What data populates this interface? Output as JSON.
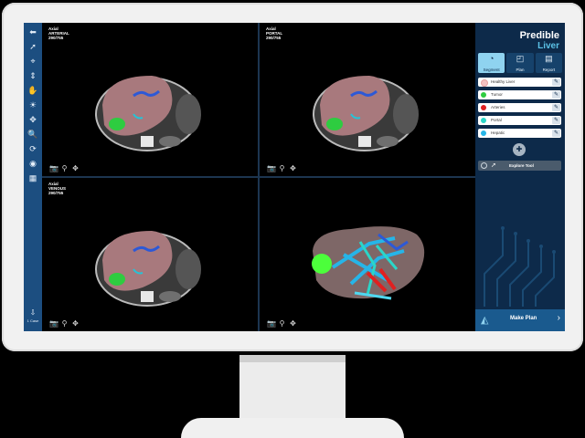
{
  "toolbar": {
    "tools": [
      {
        "name": "back-icon",
        "glyph": "⬅"
      },
      {
        "name": "pointer-icon",
        "glyph": "➚"
      },
      {
        "name": "crosshair-icon",
        "glyph": "⌖"
      },
      {
        "name": "scroll-icon",
        "glyph": "⇕"
      },
      {
        "name": "pan-hand-icon",
        "glyph": "✋"
      },
      {
        "name": "window-level-icon",
        "glyph": "☀"
      },
      {
        "name": "move-icon",
        "glyph": "✥"
      },
      {
        "name": "zoom-icon",
        "glyph": "🔍"
      },
      {
        "name": "rotate-icon",
        "glyph": "⟳"
      },
      {
        "name": "visibility-icon",
        "glyph": "◉"
      },
      {
        "name": "layout-icon",
        "glyph": "▦"
      }
    ],
    "bottom_label": "1 Case"
  },
  "viewports": [
    {
      "line1": "Axial",
      "line2": "ARTERIAL",
      "line3": "290/755"
    },
    {
      "line1": "Axial",
      "line2": "PORTAL",
      "line3": "290/755"
    },
    {
      "line1": "Axial",
      "line2": "VENOUS",
      "line3": "290/755"
    },
    {
      "line1": "",
      "line2": "",
      "line3": ""
    }
  ],
  "viewport_tools": [
    "📷",
    "⚲",
    "✥"
  ],
  "panel": {
    "brand_main": "Predible",
    "brand_sub": "Liver",
    "tabs": [
      {
        "label": "Segment",
        "icon": "◔",
        "active": true
      },
      {
        "label": "Plan",
        "icon": "◰",
        "active": false
      },
      {
        "label": "Report",
        "icon": "▤",
        "active": false
      }
    ],
    "segments": [
      {
        "label": "Healthy Liver",
        "color": "#f4c2c2"
      },
      {
        "label": "Tumor",
        "color": "#2ecc40"
      },
      {
        "label": "Arteries",
        "color": "#e02020"
      },
      {
        "label": "Portal",
        "color": "#2bd6c8"
      },
      {
        "label": "Hepatic",
        "color": "#26b5e8"
      }
    ],
    "explore_label": "Explore Tool",
    "make_plan_label": "Make Plan"
  },
  "colors": {
    "accent": "#5bc2e7",
    "panel_bg": "#0d2a4a",
    "toolbar_bg": "#1c4e80"
  }
}
